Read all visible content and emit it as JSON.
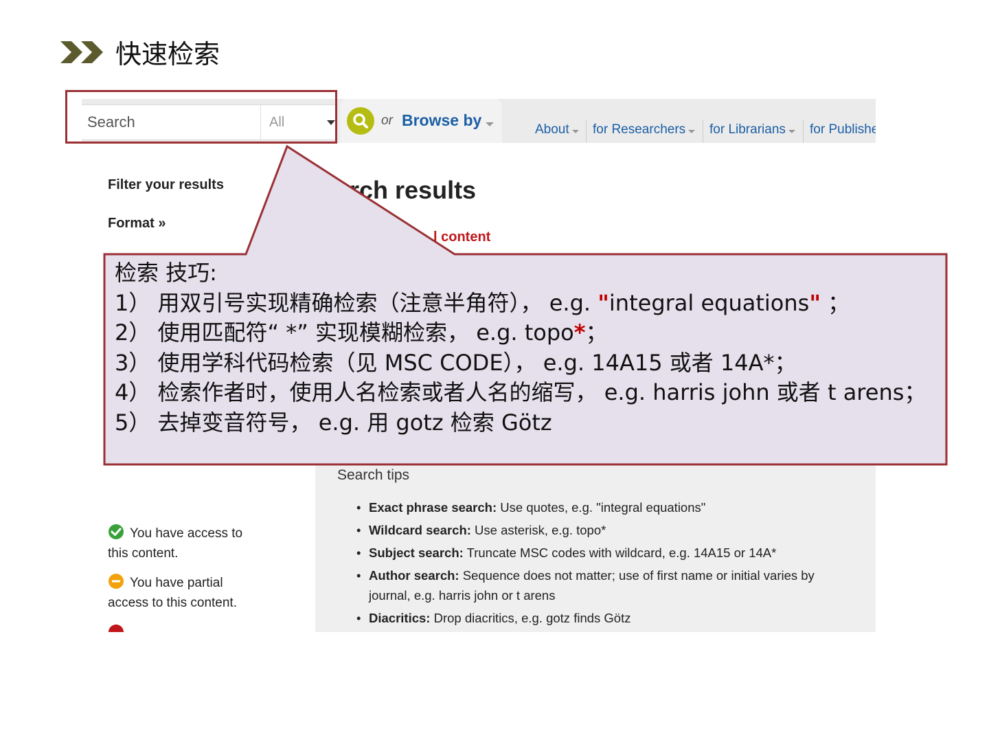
{
  "slide": {
    "title": "快速检索"
  },
  "colors": {
    "callout_border": "#9a3034",
    "callout_fill": "#e6e0ec",
    "accent_red": "#c00000",
    "link_blue": "#1b5fa6",
    "search_green": "#b6bd12"
  },
  "screenshot": {
    "search": {
      "placeholder": "Search",
      "scope": "All"
    },
    "or_text": "or",
    "browse_label": "Browse by",
    "nav": [
      {
        "label": "About"
      },
      {
        "label": "for Researchers"
      },
      {
        "label": "for Librarians"
      },
      {
        "label": "for Publishe"
      }
    ],
    "filter_title": "Filter your results",
    "format_label": "Format »",
    "results_heading": "rch results",
    "content_link": "l content",
    "tips": {
      "title": "Search tips",
      "items": [
        {
          "term": "Exact phrase search:",
          "text": " Use quotes, e.g. \"integral equations\""
        },
        {
          "term": "Wildcard search:",
          "text": " Use asterisk, e.g. topo*"
        },
        {
          "term": "Subject search:",
          "text": " Truncate MSC codes with wildcard, e.g. 14A15 or 14A*"
        },
        {
          "term": "Author search:",
          "text": " Sequence does not matter; use of first name or initial varies by journal, e.g. harris john or t arens"
        },
        {
          "term": "Diacritics:",
          "text": " Drop diacritics, e.g. gotz finds Götz"
        }
      ]
    },
    "legend": {
      "full": "You have access to this content.",
      "partial": "You have partial access to this content."
    }
  },
  "callout": {
    "heading": "检索 技巧:",
    "line1_prefix": "1） 用双引号实现精确检索（注意半角符）， e.g. ",
    "line1_q1": "\"",
    "line1_phrase": "integral equations",
    "line1_q2": "\"",
    "line1_suffix": " ；",
    "line2_prefix": "2） 使用匹配符“ *” 实现模糊检索， e.g. topo",
    "line2_star": "*",
    "line2_suffix": "；",
    "line3": "3） 使用学科代码检索（见 MSC CODE）， e.g. 14A15 或者 14A*；",
    "line4": "4） 检索作者时，使用人名检索或者人名的缩写， e.g. harris john 或者 t arens；",
    "line5": "5） 去掉变音符号， e.g. 用 gotz 检索 Götz"
  }
}
